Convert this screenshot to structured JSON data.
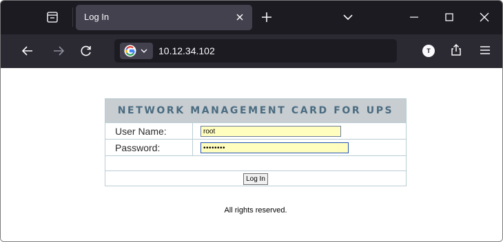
{
  "browser": {
    "tab_title": "Log In",
    "url": "10.12.34.102",
    "extension_badge": "T"
  },
  "page": {
    "header": "NETWORK MANAGEMENT CARD FOR UPS",
    "username_label": "User Name:",
    "username_value": "root",
    "password_label": "Password:",
    "password_mask": "••••••••",
    "login_button": "Log In",
    "footer": "All rights reserved."
  },
  "colors": {
    "titlebar": "#1c1b22",
    "navbar": "#2b2a33",
    "tab_active": "#42414d",
    "header_bg": "#c7cdd1",
    "header_text": "#4a6b80",
    "field_bg": "#fffebf"
  },
  "icons": [
    "tab-overview-icon",
    "close-icon",
    "plus-icon",
    "chevron-down-icon",
    "minimize-icon",
    "maximize-icon",
    "close-window-icon",
    "back-arrow-icon",
    "forward-arrow-icon",
    "reload-icon",
    "google-icon",
    "extension-icon",
    "share-icon",
    "menu-icon"
  ]
}
